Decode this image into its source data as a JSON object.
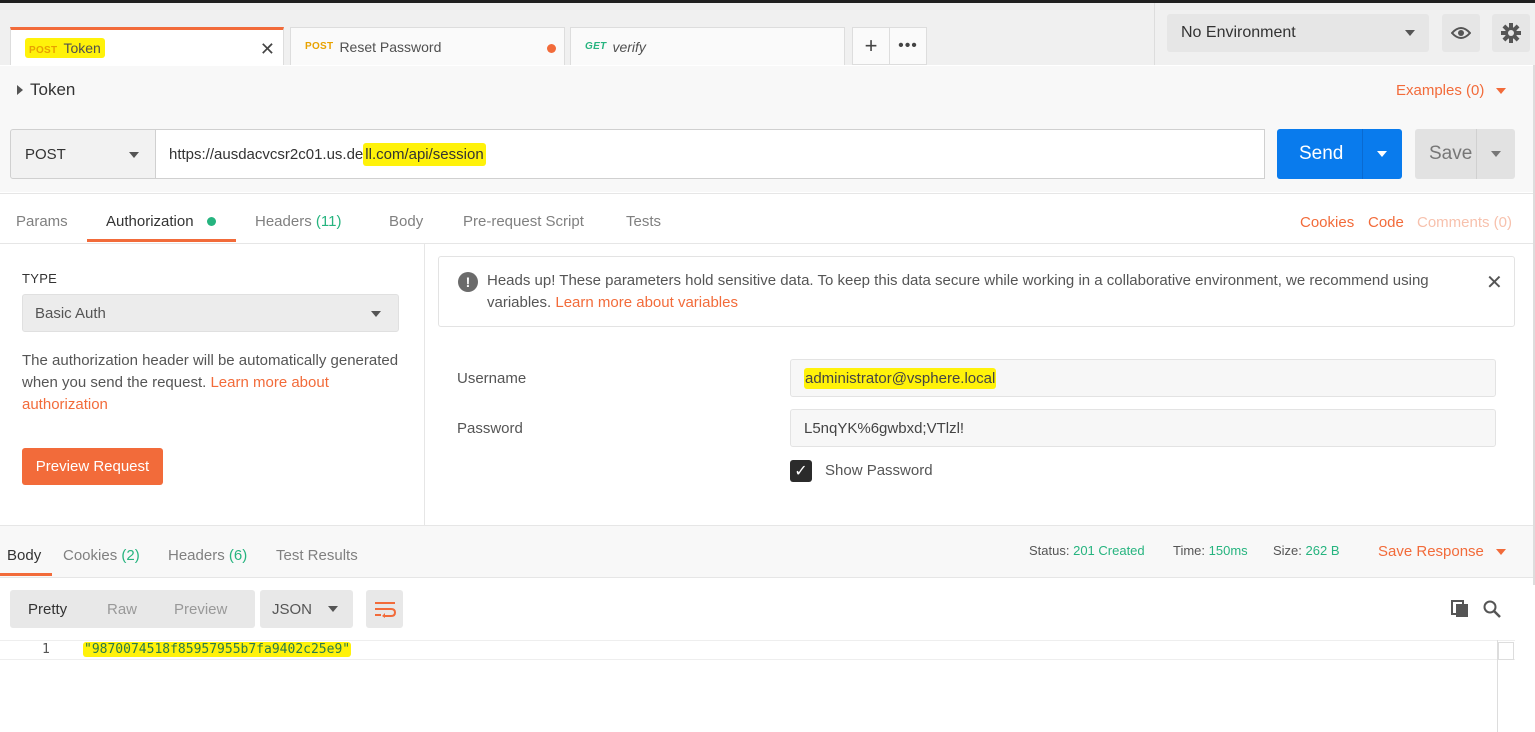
{
  "tabs": [
    {
      "method": "POST",
      "name": "Token"
    },
    {
      "method": "POST",
      "name": "Reset Password"
    },
    {
      "method": "GET",
      "name": "verify"
    }
  ],
  "environment": {
    "selected": "No Environment"
  },
  "icons": {
    "new_tab": "plus-icon",
    "more_tabs": "more-icon",
    "eye": "eye-icon",
    "settings": "gear-icon"
  },
  "request": {
    "title": "Token",
    "examples_label": "Examples (0)",
    "method": "POST",
    "url_prefix": "https://ausdacvcsr2c01.us.de",
    "url_highlight": "ll.com/api/session",
    "send_label": "Send",
    "save_label": "Save"
  },
  "request_tabs": {
    "params": "Params",
    "authorization": "Authorization",
    "headers": "Headers",
    "headers_count": "(11)",
    "body": "Body",
    "prerequest": "Pre-request Script",
    "tests": "Tests",
    "cookies": "Cookies",
    "code": "Code",
    "comments": "Comments (0)"
  },
  "auth": {
    "type_label": "TYPE",
    "type_value": "Basic Auth",
    "help_text": "The authorization header will be automatically generated when you send the request. ",
    "help_link": "Learn more about authorization",
    "preview_label": "Preview Request",
    "alert_text": "Heads up! These parameters hold sensitive data. To keep this data secure while working in a collaborative environment, we recommend using variables. ",
    "alert_link": "Learn more about variables",
    "username_label": "Username",
    "username_value": "administrator@vsphere.local",
    "password_label": "Password",
    "password_value": "L5nqYK%6gwbxd;VTlzl!",
    "show_password_label": "Show Password",
    "show_password_checked": true
  },
  "response": {
    "tabs": {
      "body": "Body",
      "cookies": "Cookies",
      "cookies_count": "(2)",
      "headers": "Headers",
      "headers_count": "(6)",
      "test_results": "Test Results"
    },
    "status_label": "Status:",
    "status_value": "201 Created",
    "time_label": "Time:",
    "time_value": "150ms",
    "size_label": "Size:",
    "size_value": "262 B",
    "save_response": "Save Response",
    "formats": {
      "pretty": "Pretty",
      "raw": "Raw",
      "preview": "Preview"
    },
    "language": "JSON",
    "line_number": "1",
    "body_value": "\"9870074518f85957955b7fa9402c25e9\""
  },
  "colors": {
    "accent": "#f26b3a",
    "send": "#097bed",
    "success": "#26b47f",
    "highlight": "#fff20a"
  }
}
